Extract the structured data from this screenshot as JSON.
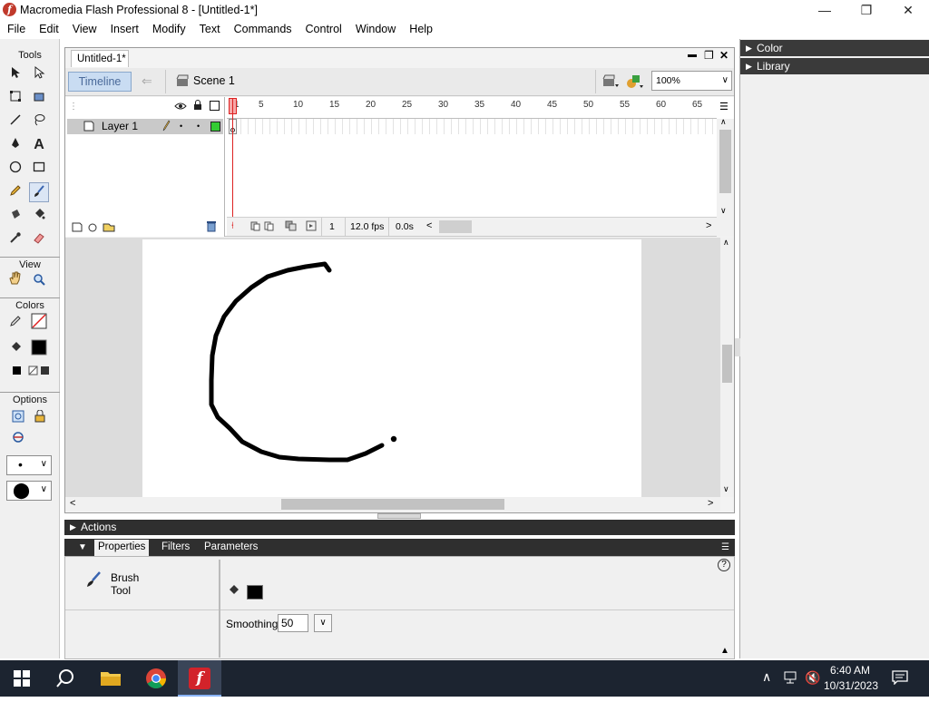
{
  "window": {
    "title": "Macromedia Flash Professional 8 - [Untitled-1*]",
    "minimize": "—",
    "maximize": "❐",
    "close": "✕"
  },
  "menu": [
    "File",
    "Edit",
    "View",
    "Insert",
    "Modify",
    "Text",
    "Commands",
    "Control",
    "Window",
    "Help"
  ],
  "tools": {
    "title": "Tools",
    "view_label": "View",
    "colors_label": "Colors",
    "options_label": "Options",
    "brush_size": "•",
    "brush_shape": "⬤"
  },
  "document": {
    "tab_title": "Untitled-1*",
    "timeline_button": "Timeline",
    "scene_label": "Scene 1",
    "zoom": "100%",
    "doc_min": "▬",
    "doc_restore": "❐",
    "doc_close": "✕"
  },
  "timeline": {
    "layer_name": "Layer 1",
    "ruler_numbers": [
      "1",
      "5",
      "10",
      "15",
      "20",
      "25",
      "30",
      "35",
      "40",
      "45",
      "50",
      "55",
      "60",
      "65"
    ],
    "current_frame": "1",
    "frame_rate": "12.0 fps",
    "elapsed": "0.0s"
  },
  "right_panels": {
    "color": "Color",
    "library": "Library"
  },
  "actions_panel": {
    "label": "Actions"
  },
  "properties_panel": {
    "tabs": [
      "Properties",
      "Filters",
      "Parameters"
    ],
    "tool_name_line1": "Brush",
    "tool_name_line2": "Tool",
    "smoothing_label": "Smoothing",
    "smoothing_value": "50",
    "help": "?"
  },
  "taskbar": {
    "time": "6:40 AM",
    "date": "10/31/2023"
  },
  "colors": {
    "accent": "#c9dcf2",
    "playhead": "#dd2222",
    "stroke_fill": "#000000"
  }
}
